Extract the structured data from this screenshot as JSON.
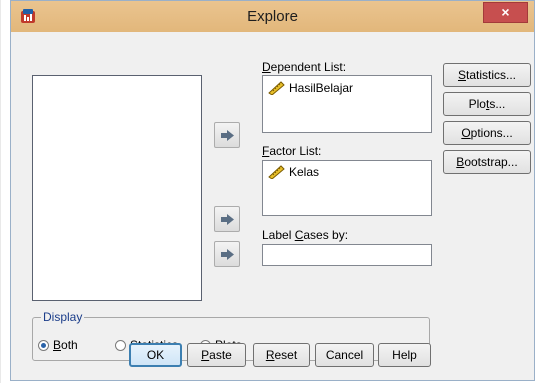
{
  "window": {
    "title": "Explore",
    "close_glyph": "×"
  },
  "dependent_list": {
    "label_prefix": "",
    "label_ul": "D",
    "label_rest": "ependent List:",
    "items": [
      "HasilBelajar"
    ]
  },
  "factor_list": {
    "label_ul": "F",
    "label_rest": "actor List:",
    "items": [
      "Kelas"
    ]
  },
  "label_cases": {
    "label_pre": "Label ",
    "label_ul": "C",
    "label_post": "ases by:",
    "value": ""
  },
  "side_buttons": {
    "statistics": {
      "ul": "S",
      "rest": "tatistics..."
    },
    "plots": {
      "pre": "Plo",
      "ul": "t",
      "rest": "s..."
    },
    "options": {
      "ul": "O",
      "rest": "ptions..."
    },
    "bootstrap": {
      "ul": "B",
      "rest": "ootstrap..."
    }
  },
  "display": {
    "title": "Display",
    "options": [
      {
        "pre": "",
        "ul": "B",
        "rest": "oth",
        "selected": true
      },
      {
        "pre": "Sta",
        "ul": "t",
        "rest": "istics",
        "selected": false
      },
      {
        "pre": "P",
        "ul": "l",
        "rest": "ots",
        "selected": false
      }
    ]
  },
  "bottom_buttons": {
    "ok": "OK",
    "paste": {
      "ul": "P",
      "rest": "aste"
    },
    "reset": {
      "ul": "R",
      "rest": "eset"
    },
    "cancel": "Cancel",
    "help": "Help"
  },
  "colors": {
    "title_bar": "#e2b77b",
    "close": "#c74f4f",
    "accent": "#3c7fb1"
  }
}
